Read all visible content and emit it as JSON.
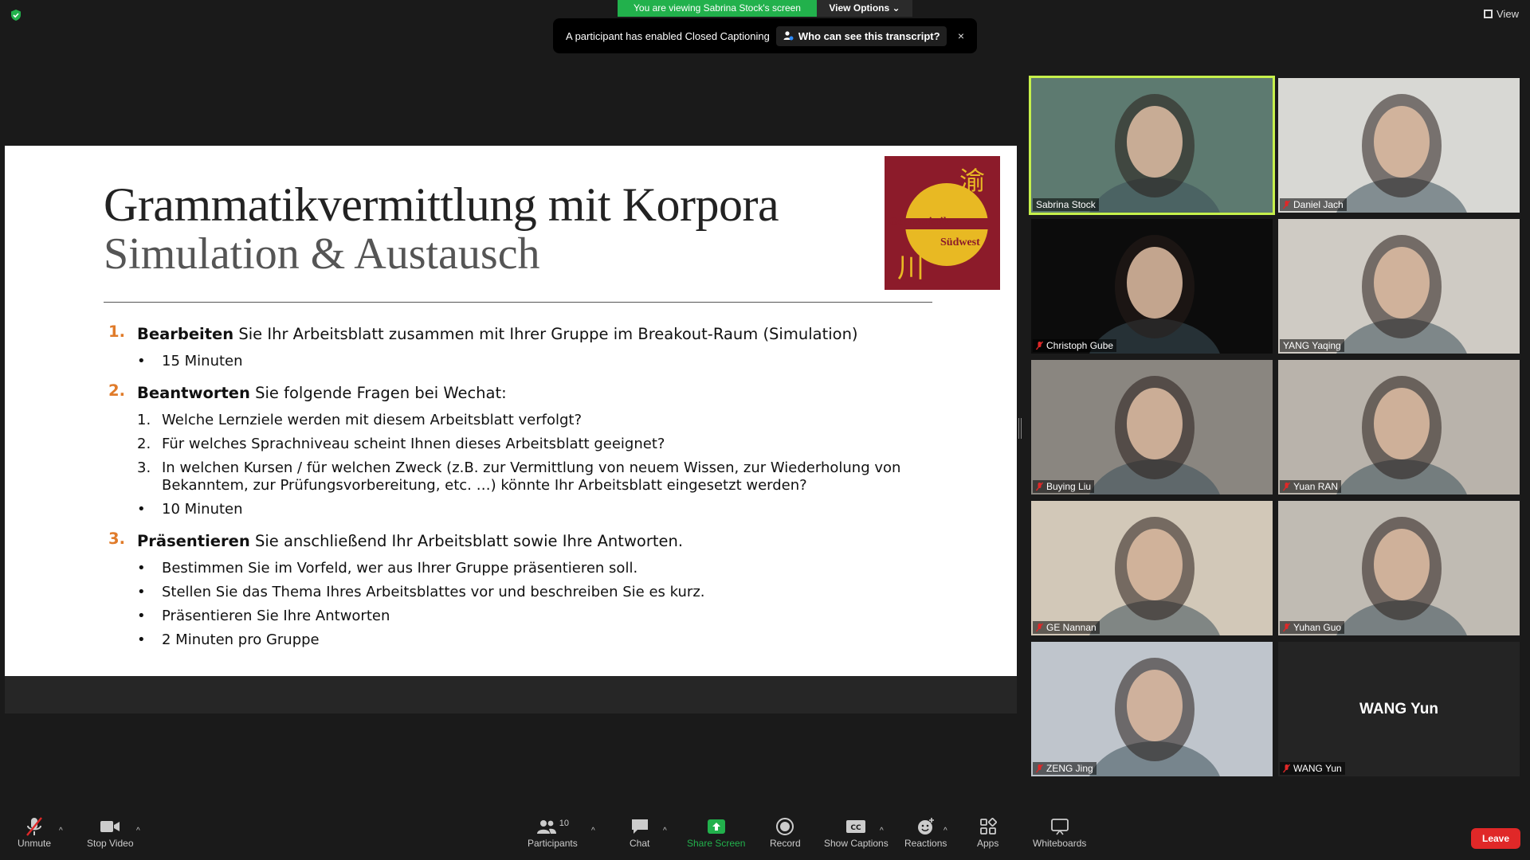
{
  "banner": {
    "viewing": "You are viewing Sabrina Stock's screen",
    "view_options": "View Options"
  },
  "view_button": "View",
  "cc_toast": {
    "message": "A participant has enabled Closed Captioning",
    "who_label": "Who can see this transcript?",
    "close": "×"
  },
  "slide": {
    "title": "Grammatikvermittlung mit Korpora",
    "subtitle": "Simulation & Austausch",
    "logo": {
      "char_top": "渝",
      "line1": "Germanistik",
      "line2": "Südwest",
      "char_bottom": "川"
    },
    "items": [
      {
        "num": "1.",
        "bold": "Bearbeiten",
        "text": " Sie Ihr Arbeitsblatt zusammen mit Ihrer Gruppe im Breakout-Raum (Simulation)",
        "subs": [
          {
            "mark": "•",
            "text": "15 Minuten"
          }
        ]
      },
      {
        "num": "2.",
        "bold": "Beantworten",
        "text": " Sie folgende Fragen bei Wechat:",
        "subs": [
          {
            "mark": "1.",
            "text": "Welche Lernziele werden mit diesem Arbeitsblatt verfolgt?"
          },
          {
            "mark": "2.",
            "text": "Für welches Sprachniveau scheint Ihnen dieses Arbeitsblatt geeignet?"
          },
          {
            "mark": "3.",
            "text": "In welchen Kursen / für welchen Zweck (z.B. zur Vermittlung von neuem Wissen, zur Wiederholung von Bekanntem, zur Prüfungsvorbereitung, etc. …) könnte Ihr Arbeitsblatt eingesetzt werden?"
          },
          {
            "mark": "•",
            "text": "10 Minuten"
          }
        ]
      },
      {
        "num": "3.",
        "bold": "Präsentieren",
        "text": " Sie anschließend Ihr Arbeitsblatt sowie Ihre Antworten.",
        "subs": [
          {
            "mark": "•",
            "text": "Bestimmen Sie im Vorfeld, wer aus Ihrer Gruppe präsentieren soll."
          },
          {
            "mark": "•",
            "text": "Stellen Sie das Thema Ihres Arbeitsblattes vor und beschreiben Sie es kurz."
          },
          {
            "mark": "•",
            "text": "Präsentieren Sie Ihre Antworten"
          },
          {
            "mark": "•",
            "text": "2 Minuten pro Gruppe"
          }
        ]
      }
    ]
  },
  "participants": [
    {
      "name": "Sabrina Stock",
      "muted": false,
      "active": true,
      "bg": "#5d7a70",
      "video": true
    },
    {
      "name": "Daniel Jach",
      "muted": true,
      "active": false,
      "bg": "#d8d8d4",
      "video": true
    },
    {
      "name": "Christoph Gube",
      "muted": true,
      "active": false,
      "bg": "#0c0c0c",
      "video": true
    },
    {
      "name": "YANG Yaqing",
      "muted": false,
      "active": false,
      "bg": "#cfcbc4",
      "video": true
    },
    {
      "name": "Buying Liu",
      "muted": true,
      "active": false,
      "bg": "#8a8680",
      "video": true
    },
    {
      "name": "Yuan RAN",
      "muted": true,
      "active": false,
      "bg": "#b9b3ab",
      "video": true
    },
    {
      "name": "GE Nannan",
      "muted": true,
      "active": false,
      "bg": "#d2c8b8",
      "video": true
    },
    {
      "name": "Yuhan Guo",
      "muted": true,
      "active": false,
      "bg": "#c0bbb3",
      "video": true
    },
    {
      "name": "ZENG Jing",
      "muted": true,
      "active": false,
      "bg": "#bfc5cc",
      "video": true
    },
    {
      "name": "WANG Yun",
      "muted": true,
      "active": false,
      "bg": "#242424",
      "video": false
    }
  ],
  "toolbar": {
    "unmute": "Unmute",
    "stop_video": "Stop Video",
    "participants": "Participants",
    "participants_count": "10",
    "chat": "Chat",
    "share_screen": "Share Screen",
    "record": "Record",
    "show_captions": "Show Captions",
    "reactions": "Reactions",
    "apps": "Apps",
    "whiteboards": "Whiteboards",
    "leave": "Leave"
  },
  "colors": {
    "accent_green": "#22b14c",
    "active_border": "#c6f04b",
    "leave_red": "#e02828",
    "list_number": "#e07b2a",
    "logo_bg": "#8c1b2a",
    "logo_gold": "#e8b923"
  }
}
